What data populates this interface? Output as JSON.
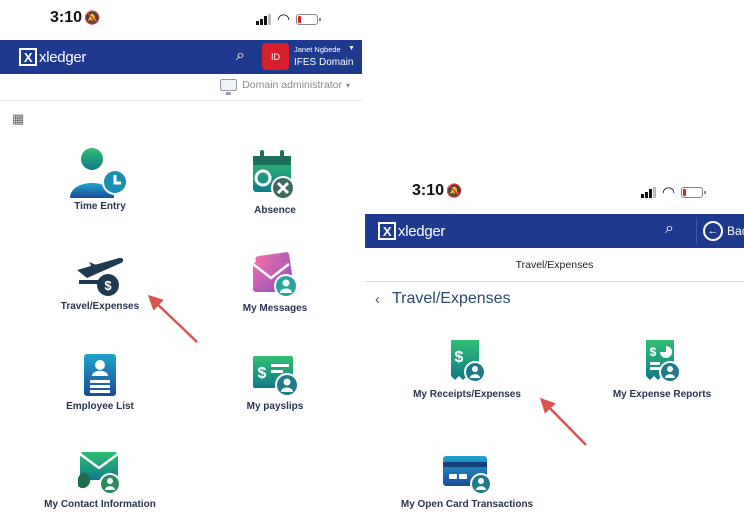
{
  "left_screen": {
    "status_time": "3:10",
    "logo_text": "xledger",
    "user_initials": "ID",
    "user_name": "Janet Ngbede",
    "domain": "IFES Domain",
    "role": "Domain administrator",
    "tiles": [
      {
        "label": "Time Entry",
        "icon": "person-clock-icon"
      },
      {
        "label": "Absence",
        "icon": "calendar-x-icon"
      },
      {
        "label": "Travel/Expenses",
        "icon": "plane-money-icon"
      },
      {
        "label": "My Messages",
        "icon": "messages-icon"
      },
      {
        "label": "Employee List",
        "icon": "id-card-icon"
      },
      {
        "label": "My payslips",
        "icon": "payslip-icon"
      },
      {
        "label": "My Contact Information",
        "icon": "contact-icon"
      }
    ]
  },
  "right_screen": {
    "status_time": "3:10",
    "logo_text": "xledger",
    "back_label": "Bac",
    "page_bar_title": "Travel/Expenses",
    "section_title": "Travel/Expenses",
    "tiles": [
      {
        "label": "My Receipts/Expenses",
        "icon": "receipt-icon"
      },
      {
        "label": "My Expense Reports",
        "icon": "expense-report-icon"
      },
      {
        "label": "My Open Card Transactions",
        "icon": "card-icon"
      }
    ]
  },
  "colors": {
    "appbar": "#1d3a8f",
    "badge": "#d7202b",
    "arrow": "#d9534f",
    "accent_teal": "#14a37a"
  }
}
